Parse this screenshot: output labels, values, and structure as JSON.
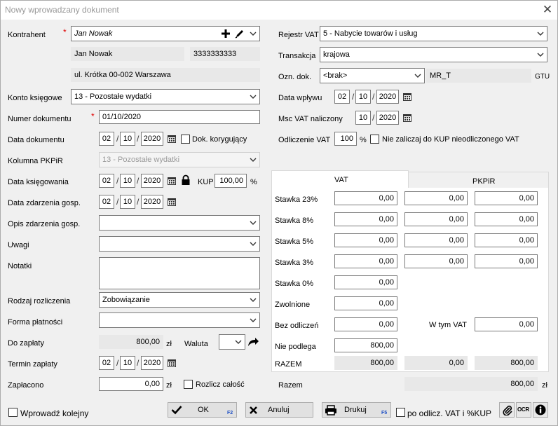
{
  "title": "Nowy wprowadzany dokument",
  "labels": {
    "kontrahent": "Kontrahent",
    "konto": "Konto księgowe",
    "numer": "Numer dokumentu",
    "data_dok": "Data dokumentu",
    "kolumna": "Kolumna PKPiR",
    "data_ksieg": "Data księgowania",
    "data_zdarz": "Data zdarzenia gosp.",
    "opis": "Opis zdarzenia gosp.",
    "uwagi": "Uwagi",
    "notatki": "Notatki",
    "rodzaj": "Rodzaj rozliczenia",
    "forma": "Forma płatności",
    "do_zaplaty": "Do zapłaty",
    "termin": "Termin zapłaty",
    "zaplacono": "Zapłacono",
    "rejestr": "Rejestr VAT",
    "transakcja": "Transakcja",
    "ozn": "Ozn. dok.",
    "data_wplywu": "Data wpływu",
    "msc_vat": "Msc VAT naliczony",
    "odliczenie": "Odliczenie VAT",
    "razem_total": "Razem"
  },
  "required_mark": "*",
  "date_sep": "/",
  "kontrahent": {
    "value": "Jan Nowak",
    "name": "Jan Nowak",
    "nip": "3333333333",
    "address": "ul. Krótka 00-002 Warszawa"
  },
  "konto": "13 - Pozostałe wydatki",
  "numer": "01/10/2020",
  "data_dokumentu": {
    "dd": "02",
    "mm": "10",
    "yyyy": "2020"
  },
  "dok_korygujacy": {
    "label": "Dok. korygujący",
    "checked": false
  },
  "kolumna": "13 - Pozostałe wydatki",
  "data_ksiegowania": {
    "dd": "02",
    "mm": "10",
    "yyyy": "2020"
  },
  "kup": {
    "label": "KUP",
    "value": "100,00",
    "unit": "%"
  },
  "data_zdarzenia": {
    "dd": "02",
    "mm": "10",
    "yyyy": "2020"
  },
  "opis": "",
  "uwagi": "",
  "notatki": "",
  "rodzaj": "Zobowiązanie",
  "forma": "",
  "do_zaplaty": {
    "value": "800,00",
    "currency": "zł"
  },
  "waluta": {
    "label": "Waluta",
    "value": ""
  },
  "termin": {
    "dd": "02",
    "mm": "10",
    "yyyy": "2020"
  },
  "zaplacono": {
    "value": "0,00",
    "currency": "zł"
  },
  "rozlicz_calosc": {
    "label": "Rozlicz całość",
    "checked": false
  },
  "rejestr": "5 - Nabycie towarów i usług",
  "transakcja": "krajowa",
  "ozn_dok": {
    "value": "<brak>",
    "mr": "MR_T",
    "gtu": "GTU"
  },
  "data_wplywu": {
    "dd": "02",
    "mm": "10",
    "yyyy": "2020"
  },
  "msc_vat": {
    "mm": "10",
    "yyyy": "2020"
  },
  "odliczenie": {
    "value": "100",
    "unit": "%"
  },
  "nie_zaliczaj": {
    "label": "Nie zaliczaj do KUP nieodliczonego VAT",
    "checked": false
  },
  "tabs": {
    "vat": "VAT",
    "pkpir": "PKPiR",
    "active": "VAT"
  },
  "vat_rows": [
    {
      "label": "Stawka 23%",
      "netto": "0,00",
      "vat": "0,00",
      "brutto": "0,00"
    },
    {
      "label": "Stawka 8%",
      "netto": "0,00",
      "vat": "0,00",
      "brutto": "0,00"
    },
    {
      "label": "Stawka 5%",
      "netto": "0,00",
      "vat": "0,00",
      "brutto": "0,00"
    },
    {
      "label": "Stawka 3%",
      "netto": "0,00",
      "vat": "0,00",
      "brutto": "0,00"
    },
    {
      "label": "Stawka 0%",
      "netto": "0,00"
    },
    {
      "label": "Zwolnione",
      "netto": "0,00"
    },
    {
      "label": "Bez odliczeń",
      "netto": "0,00"
    },
    {
      "label": "Nie podlega",
      "netto": "800,00"
    }
  ],
  "w_tym_vat": {
    "label": "W tym VAT",
    "value": "0,00"
  },
  "razem_row": {
    "label": "RAZEM",
    "netto": "800,00",
    "vat": "0,00",
    "brutto": "800,00"
  },
  "razem_total": {
    "value": "800,00",
    "currency": "zł"
  },
  "bottom": {
    "wprowadz_kolejny": {
      "label": "Wprowadź kolejny",
      "checked": false
    },
    "ok": {
      "label": "OK",
      "key": "F2"
    },
    "anuluj": {
      "label": "Anuluj"
    },
    "drukuj": {
      "label": "Drukuj",
      "key": "F5"
    },
    "po_odlicz": {
      "label": "po odlicz. VAT i %KUP",
      "checked": false
    },
    "ocr": "OCR"
  },
  "icons": [
    "close-icon",
    "add-icon",
    "edit-icon",
    "calendar-icon",
    "lock-icon",
    "chevron-down-icon",
    "arrow-icon",
    "checkmark-icon",
    "cancel-x-icon",
    "printer-icon",
    "paperclip-icon",
    "ocr-icon",
    "info-icon"
  ]
}
